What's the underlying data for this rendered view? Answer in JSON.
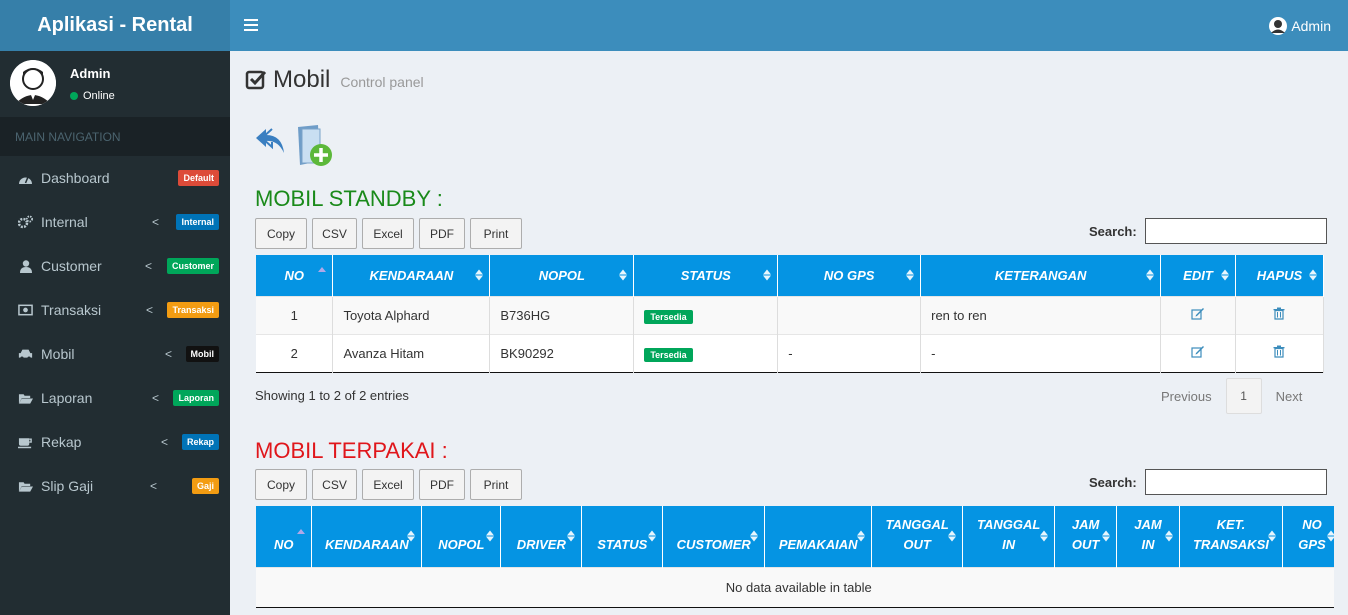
{
  "app": {
    "title": "Aplikasi - Rental"
  },
  "navbar": {
    "user_label": "Admin"
  },
  "sidebar": {
    "user_name": "Admin",
    "user_status": "Online",
    "nav_header": "MAIN NAVIGATION",
    "items": [
      {
        "label": "Dashboard",
        "badge": "Default",
        "badge_color": "#dd4b39",
        "icon": "dashboard-icon"
      },
      {
        "label": "Internal",
        "badge": "Internal",
        "badge_color": "#0073b7",
        "icon": "gears-icon"
      },
      {
        "label": "Customer",
        "badge": "Customer",
        "badge_color": "#00a65a",
        "icon": "user-icon"
      },
      {
        "label": "Transaksi",
        "badge": "Transaksi",
        "badge_color": "#f39c12",
        "icon": "money-icon"
      },
      {
        "label": "Mobil",
        "badge": "Mobil",
        "badge_color": "#111111",
        "icon": "car-icon"
      },
      {
        "label": "Laporan",
        "badge": "Laporan",
        "badge_color": "#00a65a",
        "icon": "folder-open-icon"
      },
      {
        "label": "Rekap",
        "badge": "Rekap",
        "badge_color": "#0073b7",
        "icon": "coffee-icon"
      },
      {
        "label": "Slip Gaji",
        "badge": "Gaji",
        "badge_color": "#f39c12",
        "icon": "folder-open-icon"
      }
    ]
  },
  "page": {
    "title": "Mobil",
    "subtitle": "Control panel"
  },
  "export_buttons": [
    "Copy",
    "CSV",
    "Excel",
    "PDF",
    "Print"
  ],
  "standby": {
    "heading": "MOBIL STANDBY :",
    "heading_color": "#1a8a1a",
    "search_label": "Search:",
    "columns": [
      "NO",
      "KENDARAAN",
      "NOPOL",
      "STATUS",
      "NO GPS",
      "KETERANGAN",
      "EDIT",
      "HAPUS"
    ],
    "rows": [
      {
        "no": "1",
        "kendaraan": "Toyota Alphard",
        "nopol": "B736HG",
        "status": "Tersedia",
        "no_gps": "",
        "keterangan": "ren to ren"
      },
      {
        "no": "2",
        "kendaraan": "Avanza Hitam",
        "nopol": "BK90292",
        "status": "Tersedia",
        "no_gps": "-",
        "keterangan": "-"
      }
    ],
    "info": "Showing 1 to 2 of 2 entries",
    "pager": {
      "prev": "Previous",
      "page": "1",
      "next": "Next"
    }
  },
  "terpakai": {
    "heading": "MOBIL TERPAKAI :",
    "heading_color": "#e0161b",
    "search_label": "Search:",
    "columns": [
      {
        "l1": "",
        "l2": "NO"
      },
      {
        "l1": "",
        "l2": "KENDARAAN"
      },
      {
        "l1": "",
        "l2": "NOPOL"
      },
      {
        "l1": "",
        "l2": "DRIVER"
      },
      {
        "l1": "",
        "l2": "STATUS"
      },
      {
        "l1": "",
        "l2": "CUSTOMER"
      },
      {
        "l1": "",
        "l2": "PEMAKAIAN"
      },
      {
        "l1": "TANGGAL",
        "l2": "OUT"
      },
      {
        "l1": "TANGGAL",
        "l2": "IN"
      },
      {
        "l1": "JAM",
        "l2": "OUT"
      },
      {
        "l1": "JAM",
        "l2": "IN"
      },
      {
        "l1": "KET.",
        "l2": "TRANSAKSI"
      },
      {
        "l1": "NO",
        "l2": "GPS"
      }
    ],
    "empty": "No data available in table"
  }
}
